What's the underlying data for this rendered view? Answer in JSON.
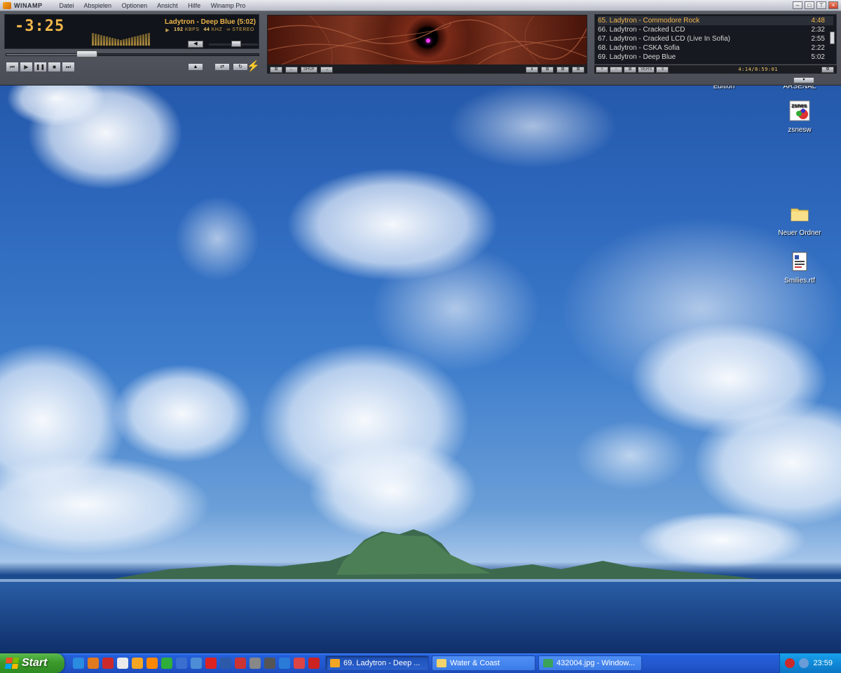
{
  "winamp": {
    "brand": "WINAMP",
    "menu": [
      "Datei",
      "Abspielen",
      "Optionen",
      "Ansicht",
      "Hilfe",
      "Winamp Pro"
    ],
    "time": "-3:25",
    "song_title": "Ladytron - Deep Blue (5:02)",
    "kbps": "192",
    "kbps_unit": "KBPS",
    "khz": "44",
    "khz_unit": "KHZ",
    "stereo": "STEREO",
    "seek_fraction": 0.32,
    "volume_fraction": 0.55,
    "playlist": [
      {
        "title": "65. Ladytron - Commodore Rock",
        "length": "4:48",
        "current": true
      },
      {
        "title": "66. Ladytron - Cracked LCD",
        "length": "2:32",
        "current": false
      },
      {
        "title": "67. Ladytron - Cracked LCD (Live In Sofia)",
        "length": "2:55",
        "current": false
      },
      {
        "title": "68. Ladytron - CSKA Sofia",
        "length": "2:22",
        "current": false
      },
      {
        "title": "69. Ladytron - Deep Blue",
        "length": "5:02",
        "current": false
      }
    ],
    "playlist_counter": "4:14/8:59:01",
    "playlist_buttons": [
      "+",
      "−",
      "⊞",
      "VERS",
      "≡"
    ],
    "vis_buttons_left": [
      "⊞",
      "←",
      "SHUF",
      "→"
    ],
    "vis_buttons_right": [
      "ℹ",
      "⊞",
      "⊞",
      "⊞"
    ],
    "accent_color": "#f2b74a"
  },
  "desktop": {
    "icons": [
      {
        "name": "Edition",
        "icon": "partial-label"
      },
      {
        "name": "ARSENAL",
        "icon": "partial-label"
      },
      {
        "name": "zsnesw",
        "icon": "zsnes-shortcut-icon"
      },
      {
        "name": "Neuer Ordner",
        "icon": "folder-icon"
      },
      {
        "name": "Smilies.rtf",
        "icon": "rtf-document-icon"
      }
    ]
  },
  "taskbar": {
    "start_label": "Start",
    "quick_launch": [
      "ie-icon",
      "firefox-icon",
      "opera-icon",
      "media-icon",
      "winamp-icon",
      "vlc-icon",
      "green-app-icon",
      "network-icon",
      "image-icon",
      "acrobat-icon",
      "word-icon",
      "flag-icon",
      "gear-icon",
      "headphones-icon",
      "messenger-icon",
      "no-icon",
      "opera-small-icon"
    ],
    "tasks": [
      {
        "label": "69. Ladytron - Deep ...",
        "icon": "winamp-icon",
        "active": true
      },
      {
        "label": "Water & Coast",
        "icon": "folder-icon",
        "active": false
      },
      {
        "label": "432004.jpg - Window...",
        "icon": "image-viewer-icon",
        "active": false
      }
    ],
    "clock": "23:59"
  }
}
